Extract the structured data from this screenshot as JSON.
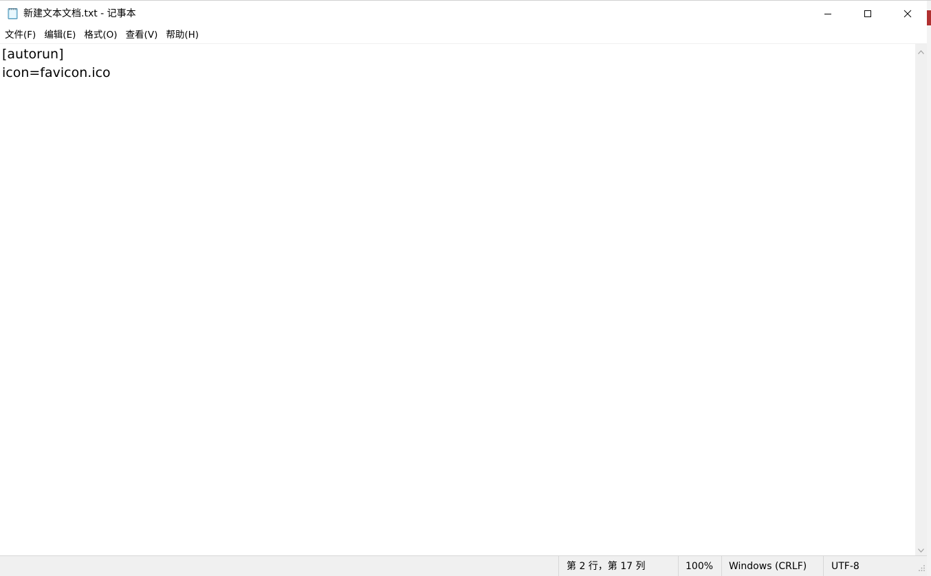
{
  "window": {
    "title": "新建文本文档.txt - 记事本"
  },
  "icons": {
    "app": "notepad-icon",
    "minimize": "minimize-icon",
    "maximize": "maximize-icon",
    "close": "close-icon",
    "scroll_up": "chevron-up-icon",
    "scroll_down": "chevron-down-icon",
    "resize": "resize-grip-icon"
  },
  "menu": {
    "items": [
      "文件(F)",
      "编辑(E)",
      "格式(O)",
      "查看(V)",
      "帮助(H)"
    ]
  },
  "editor": {
    "lines": [
      "[autorun]",
      "icon=favicon.ico"
    ]
  },
  "statusbar": {
    "position": "第 2 行，第 17 列",
    "zoom": "100%",
    "line_ending": "Windows (CRLF)",
    "encoding": "UTF-8"
  },
  "colors": {
    "background": "#ffffff",
    "statusbar": "#f0f0f0",
    "border": "#d7d7d7"
  }
}
